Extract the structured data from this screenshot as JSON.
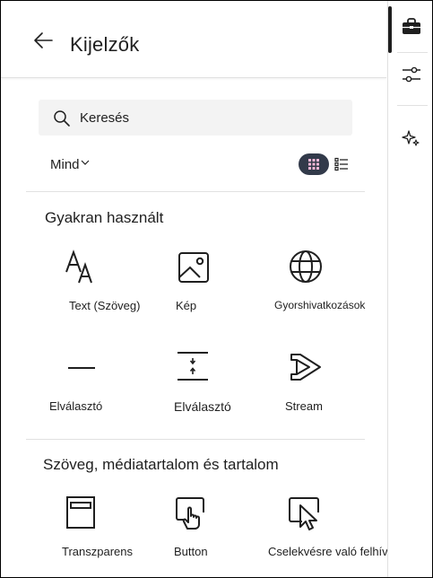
{
  "header": {
    "title": "Kijelzők",
    "back_icon": "arrow-left-icon"
  },
  "search": {
    "placeholder": "Keresés",
    "value": ""
  },
  "filter": {
    "label": "Mind"
  },
  "view_toggle": {
    "active": "grid"
  },
  "sections": [
    {
      "title": "Gyakran használt",
      "items": [
        {
          "label": "Text (Szöveg)",
          "icon": "text-size-icon"
        },
        {
          "label": "Kép",
          "icon": "image-icon"
        },
        {
          "label": "Gyorshivatkozások",
          "icon": "globe-icon"
        },
        {
          "label": "Elválasztó",
          "icon": "horizontal-line-icon"
        },
        {
          "label": "Elválasztó",
          "icon": "spacer-icon"
        },
        {
          "label": "Stream",
          "icon": "stream-play-icon"
        }
      ]
    },
    {
      "title": "Szöveg, médiatartalom és tartalom",
      "items": [
        {
          "label": "Transzparens",
          "icon": "banner-icon"
        },
        {
          "label": "Button",
          "icon": "button-touch-icon"
        },
        {
          "label": "Cselekvésre való felhívás",
          "icon": "call-to-action-icon"
        }
      ]
    }
  ],
  "rail": [
    {
      "name": "toolbox-icon",
      "active": true
    },
    {
      "name": "sliders-icon",
      "active": false
    },
    {
      "name": "sparkle-icon",
      "active": false
    }
  ],
  "colors": {
    "accent_dark": "#323a4a",
    "text": "#1f1f1f",
    "search_bg": "#f3f3f3",
    "divider": "#e1e1e1"
  }
}
